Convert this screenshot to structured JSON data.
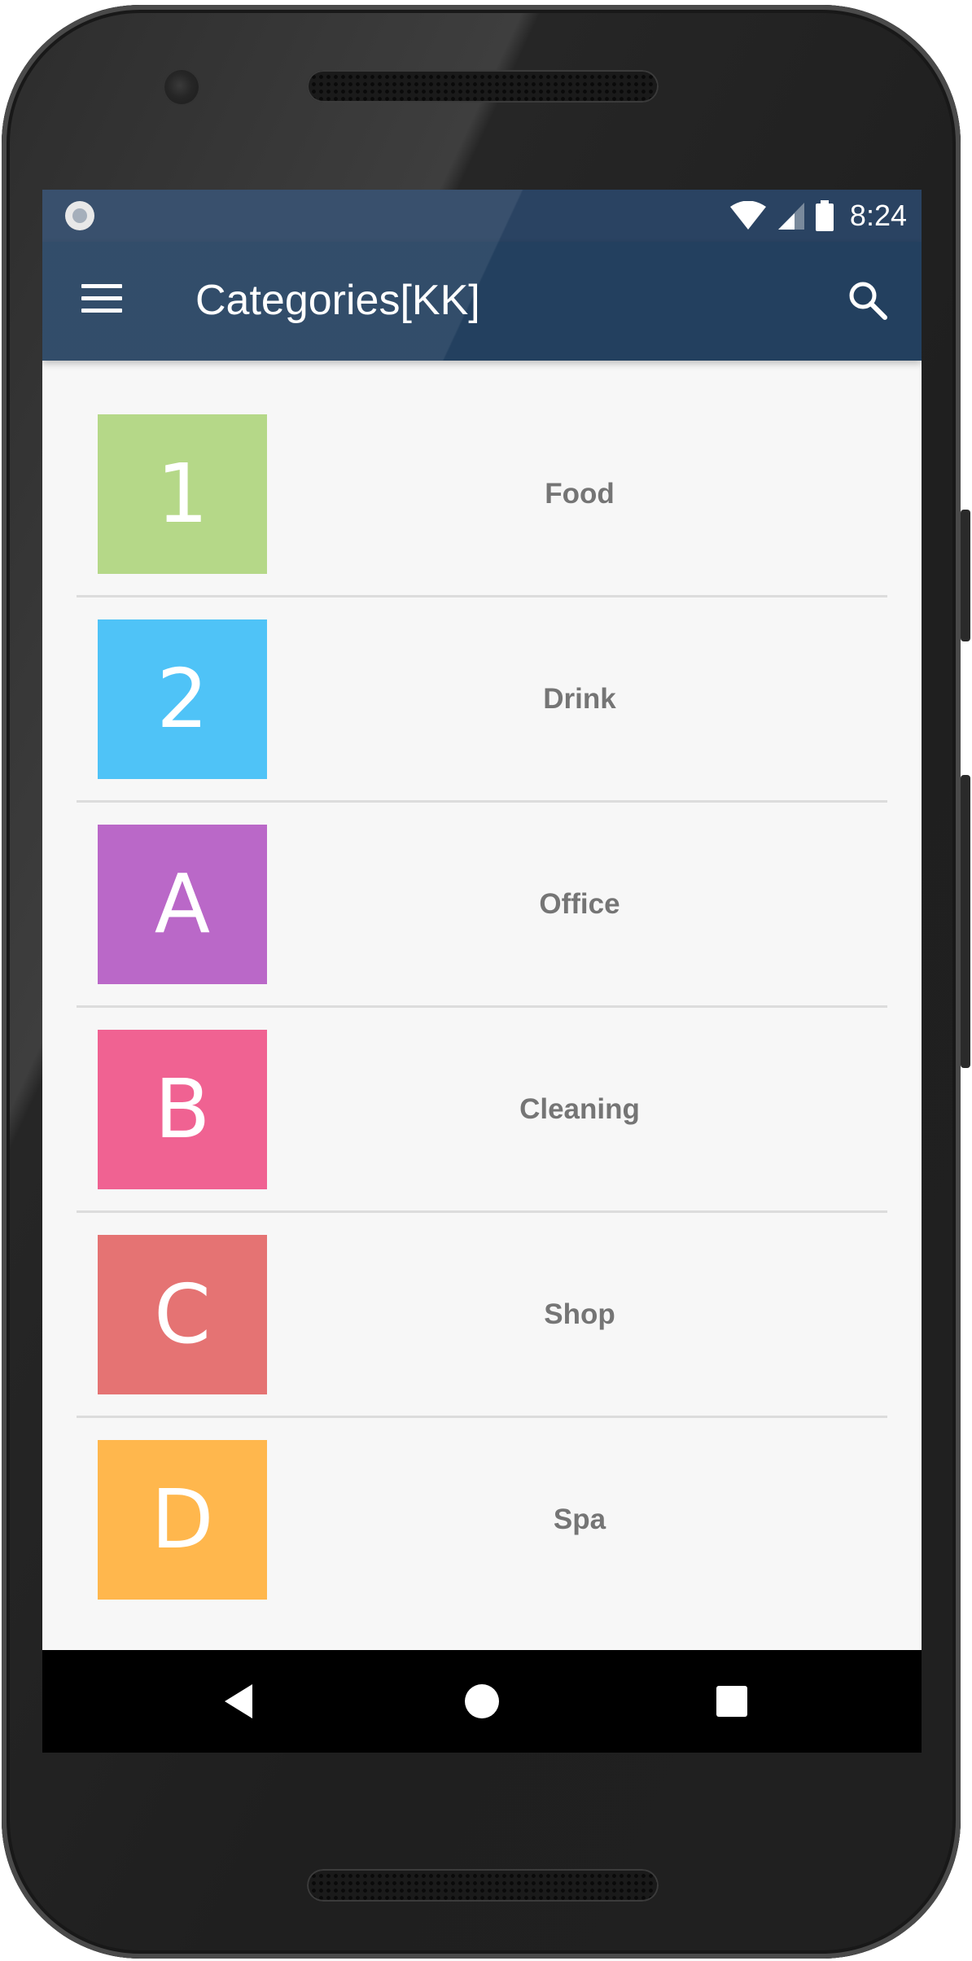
{
  "status_bar": {
    "time": "8:24"
  },
  "app_bar": {
    "title": "Categories[KK]",
    "menu_icon": "menu-icon",
    "search_icon": "search-icon",
    "color": "#23405f"
  },
  "categories": [
    {
      "badge": "1",
      "label": "Food",
      "color": "#b5d888"
    },
    {
      "badge": "2",
      "label": "Drink",
      "color": "#4fc3f7"
    },
    {
      "badge": "A",
      "label": "Office",
      "color": "#ba68c8"
    },
    {
      "badge": "B",
      "label": "Cleaning",
      "color": "#f06292"
    },
    {
      "badge": "C",
      "label": "Shop",
      "color": "#e57373"
    },
    {
      "badge": "D",
      "label": "Spa",
      "color": "#ffb74d"
    }
  ],
  "nav_bar": {
    "back_icon": "back-icon",
    "home_icon": "home-icon",
    "recents_icon": "recents-icon"
  }
}
